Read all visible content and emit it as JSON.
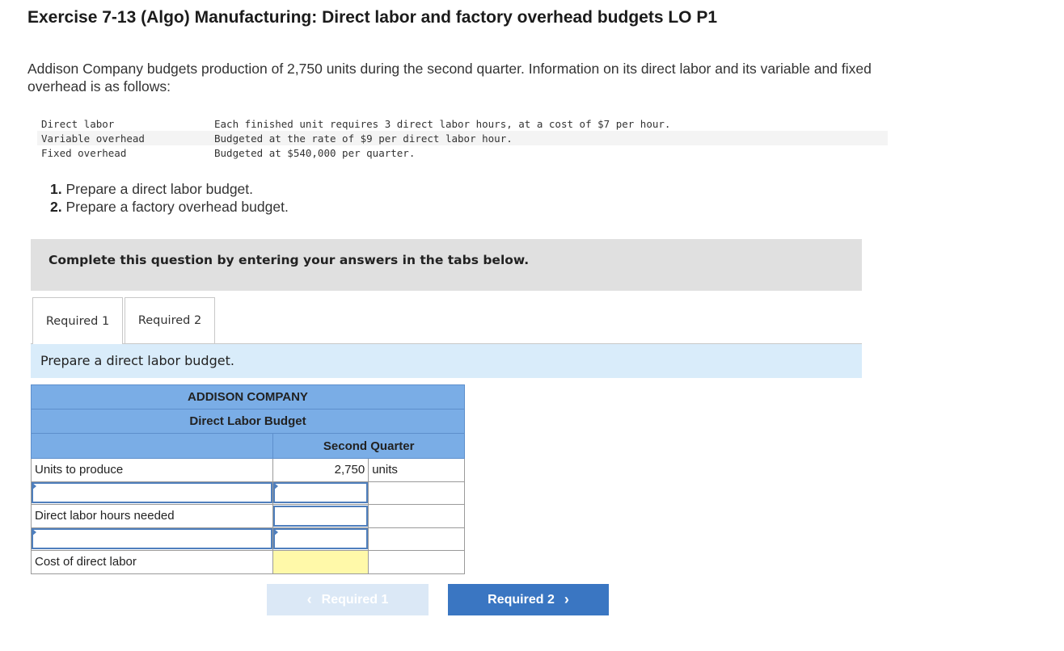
{
  "page": {
    "title": "Exercise 7-13 (Algo) Manufacturing: Direct labor and factory overhead budgets LO P1",
    "intro": "Addison Company budgets production of 2,750 units during the second quarter. Information on its direct labor and its variable and fixed overhead is as follows:"
  },
  "info": [
    {
      "label": "Direct labor",
      "text": "Each finished unit requires 3 direct labor hours, at a cost of $7 per hour."
    },
    {
      "label": "Variable overhead",
      "text": "Budgeted at the rate of $9 per direct labor hour."
    },
    {
      "label": "Fixed overhead",
      "text": "Budgeted at $540,000 per quarter."
    }
  ],
  "requirements": [
    {
      "num": "1.",
      "text": "Prepare a direct labor budget."
    },
    {
      "num": "2.",
      "text": "Prepare a factory overhead budget."
    }
  ],
  "banner": "Complete this question by entering your answers in the tabs below.",
  "tabs": [
    "Required 1",
    "Required 2"
  ],
  "instruction": "Prepare a direct labor budget.",
  "budget": {
    "company": "ADDISON COMPANY",
    "name": "Direct Labor Budget",
    "column": "Second Quarter",
    "rows": {
      "units_label": "Units to produce",
      "units_value": "2,750",
      "units_unit": "units",
      "hours_label": "Direct labor hours needed",
      "cost_label": "Cost of direct labor"
    }
  },
  "nav": {
    "prev": "Required 1",
    "next": "Required 2"
  },
  "colors": {
    "header_blue": "#7aade6",
    "instruction_bg": "#d9ecfa",
    "next_button": "#3a76c2",
    "highlight_yellow": "#fff9a9"
  }
}
